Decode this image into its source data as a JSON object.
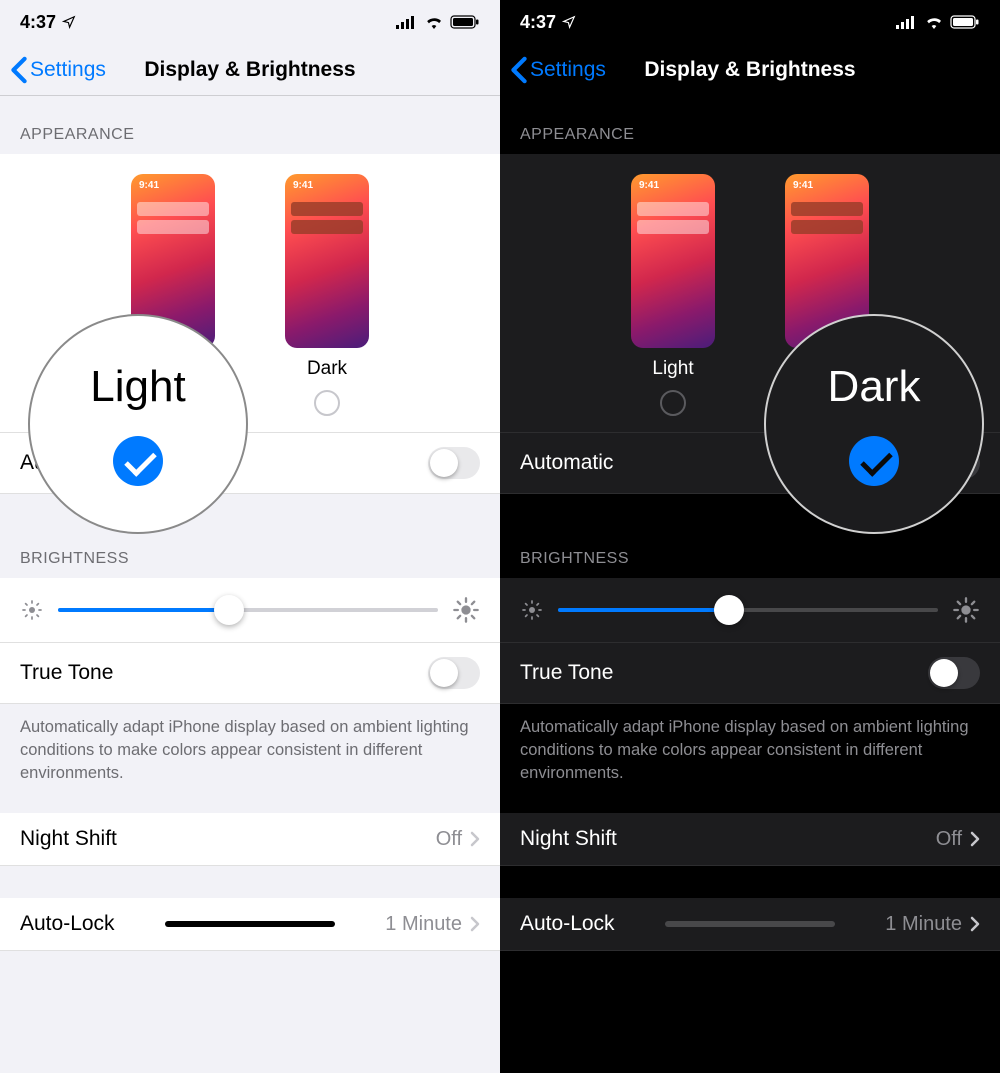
{
  "status": {
    "time": "4:37"
  },
  "nav": {
    "back": "Settings",
    "title": "Display & Brightness"
  },
  "sections": {
    "appearance_label": "APPEARANCE",
    "brightness_label": "BRIGHTNESS"
  },
  "appearance": {
    "light_label": "Light",
    "dark_label": "Dark",
    "preview_time": "9:41",
    "automatic_label": "Automatic",
    "automatic_on": false
  },
  "brightness": {
    "percent": 45,
    "true_tone_label": "True Tone",
    "true_tone_on": false,
    "true_tone_desc": "Automatically adapt iPhone display based on ambient lighting conditions to make colors appear consistent in different environments."
  },
  "rows": {
    "night_shift_label": "Night Shift",
    "night_shift_value": "Off",
    "auto_lock_label": "Auto-Lock",
    "auto_lock_value": "1 Minute"
  },
  "magnifier": {
    "light_big": "Light",
    "dark_big": "Dark"
  },
  "colors": {
    "accent": "#007aff"
  }
}
